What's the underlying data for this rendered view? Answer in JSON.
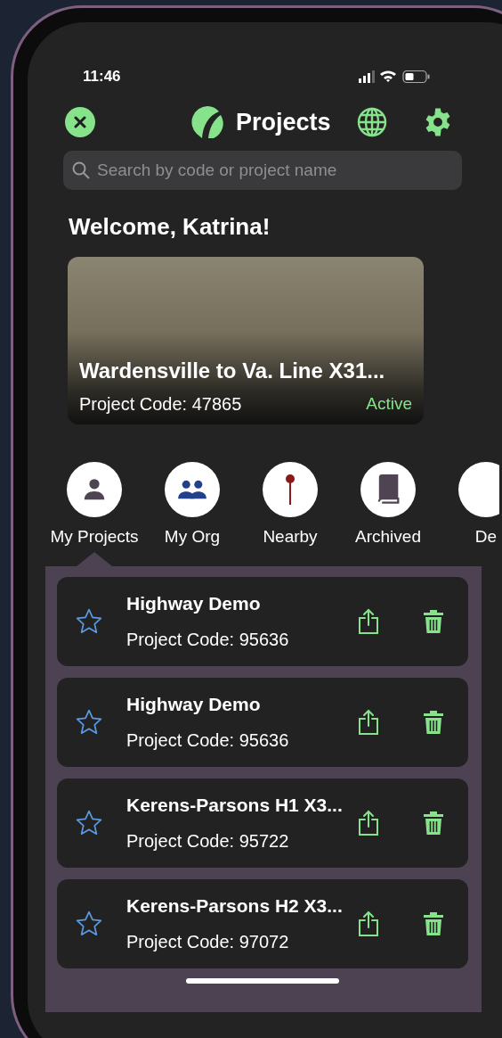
{
  "status_bar": {
    "time": "11:46"
  },
  "header": {
    "title": "Projects"
  },
  "search": {
    "placeholder": "Search by code or project name"
  },
  "welcome": "Welcome, Katrina!",
  "featured": {
    "title": "Wardensville to Va. Line X31...",
    "code": "Project Code: 47865",
    "status": "Active"
  },
  "categories": [
    {
      "label": "My Projects",
      "kind": "person",
      "selected": true
    },
    {
      "label": "My Org",
      "kind": "group",
      "selected": false
    },
    {
      "label": "Nearby",
      "kind": "pin",
      "selected": false
    },
    {
      "label": "Archived",
      "kind": "book",
      "selected": false
    },
    {
      "label": "De",
      "kind": "partial",
      "selected": false
    }
  ],
  "projects": [
    {
      "name": "Highway Demo",
      "code": "Project Code: 95636",
      "favorite": false
    },
    {
      "name": "Highway Demo",
      "code": "Project Code: 95636",
      "favorite": false
    },
    {
      "name": "Kerens-Parsons H1 X3...",
      "code": "Project Code: 95722",
      "favorite": false
    },
    {
      "name": "Kerens-Parsons H2 X3...",
      "code": "Project Code: 97072",
      "favorite": false
    }
  ]
}
